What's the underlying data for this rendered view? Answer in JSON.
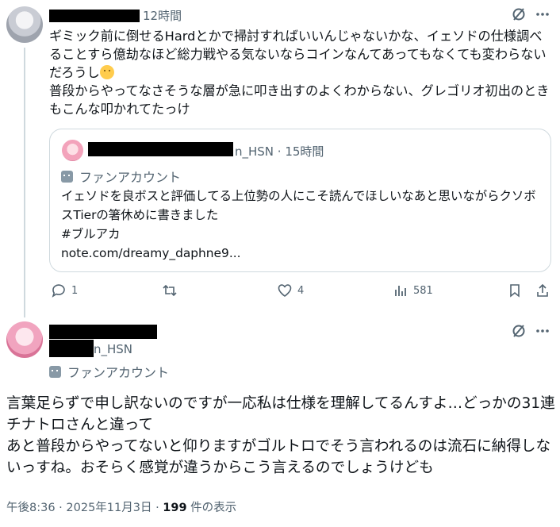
{
  "tweet1": {
    "time": "12時間",
    "body": "ギミック前に倒せるHardとかで掃討すればいいんじゃないかな、イェソドの仕様調べることすら億劫なほど総力戦やる気ないならコインなんてあってもなくても変わらないだろうし",
    "body2": "\n普段からやってなさそうな層が急に叩き出すのよくわからない、グレゴリオ初出のときもこんな叩かれてたっけ",
    "emoji": "thinking-face-icon",
    "quote": {
      "handle": "n_HSN · 15時間",
      "badge": "ファンアカウント",
      "text": "イェソドを良ボスと評価してる上位勢の人にこそ読んでほしいなあと思いながらクソボスTierの箸休めに書きました\n#ブルアカ\nnote.com/dreamy_daphne9..."
    },
    "actions": {
      "replies": "1",
      "retweets": "",
      "likes": "4",
      "views": "581"
    }
  },
  "tweet2": {
    "handle": "n_HSN",
    "badge": "ファンアカウント",
    "body": "言葉足らずで申し訳ないのですが一応私は仕様を理解してるんすよ…どっかの31連チナトロさんと違って\nあと普段からやってないと仰りますがゴルトロでそう言われるのは流石に納得しないっすね。おそらく感覚が違うからこう言えるのでしょうけども",
    "timestamp": "午後8:36 · 2025年11月3日 · ",
    "view_count": "199",
    "view_label": " 件の表示"
  }
}
